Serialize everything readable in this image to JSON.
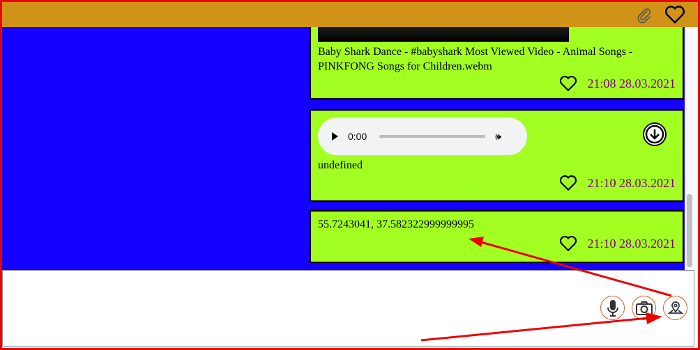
{
  "header": {
    "icons": [
      "paperclip-icon",
      "heart-icon"
    ]
  },
  "messages": [
    {
      "type": "video",
      "caption": "Baby Shark Dance - #babyshark Most Viewed Video - Animal Songs - PINKFONG Songs for Children.webm",
      "time": "21:08 28.03.2021"
    },
    {
      "type": "audio",
      "player_time": "0:00",
      "caption": "undefined",
      "time": "21:10 28.03.2021"
    },
    {
      "type": "location",
      "text": "55.7243041, 37.582322999999995",
      "time": "21:10 28.03.2021"
    }
  ],
  "composer": {
    "buttons": [
      "microphone-icon",
      "camera-icon",
      "location-pin-icon"
    ]
  },
  "colors": {
    "header": "#D09318",
    "chat_bg": "#1400FF",
    "card_bg": "#A3FF22",
    "time": "#800080",
    "annotation": "#E00000"
  }
}
